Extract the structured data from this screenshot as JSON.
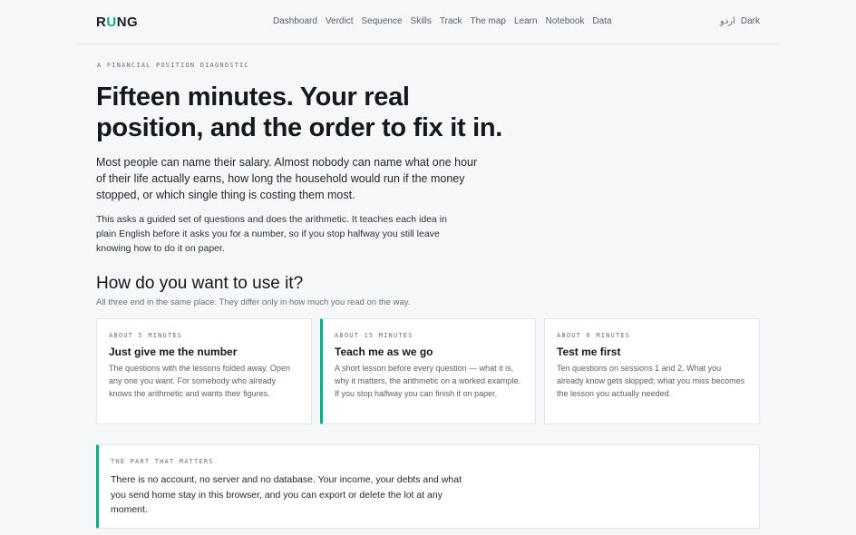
{
  "header": {
    "logo_pre": "R",
    "logo_accent": "U",
    "logo_post": "NG",
    "nav": [
      "Dashboard",
      "Verdict",
      "Sequence",
      "Skills",
      "Track",
      "The map",
      "Learn",
      "Notebook",
      "Data"
    ],
    "language": "اردو",
    "theme": "Dark"
  },
  "hero": {
    "eyebrow": "A FINANCIAL POSITION DIAGNOSTIC",
    "title": "Fifteen minutes. Your real position, and the order to fix it in.",
    "lead": "Most people can name their salary. Almost nobody can name what one hour of their life actually earns, how long the household would run if the money stopped, or which single thing is costing them most.",
    "body": "This asks a guided set of questions and does the arithmetic. It teaches each idea in plain English before it asks you for a number, so if you stop halfway you still leave knowing how to do it on paper."
  },
  "modes": {
    "title": "How do you want to use it?",
    "subtitle": "All three end in the same place. They differ only in how much you read on the way.",
    "cards": [
      {
        "eyebrow": "ABOUT 5 MINUTES",
        "title": "Just give me the number",
        "text": "The questions with the lessons folded away. Open any one you want. For somebody who already knows the arithmetic and wants their figures."
      },
      {
        "eyebrow": "ABOUT 15 MINUTES",
        "title": "Teach me as we go",
        "text": "A short lesson before every question — what it is, why it matters, the arithmetic on a worked example. If you stop halfway you can finish it on paper."
      },
      {
        "eyebrow": "ABOUT 6 MINUTES",
        "title": "Test me first",
        "text": "Ten questions on sessions 1 and 2. What you already know gets skipped; what you miss becomes the lesson you actually needed."
      }
    ]
  },
  "notice": {
    "eyebrow": "THE PART THAT MATTERS",
    "text": "There is no account, no server and no database. Your income, your debts and what you send home stay in this browser, and you can export or delete the lot at any moment."
  },
  "colors": {
    "accent": "#1aa58a",
    "background": "#f6f7f8"
  }
}
